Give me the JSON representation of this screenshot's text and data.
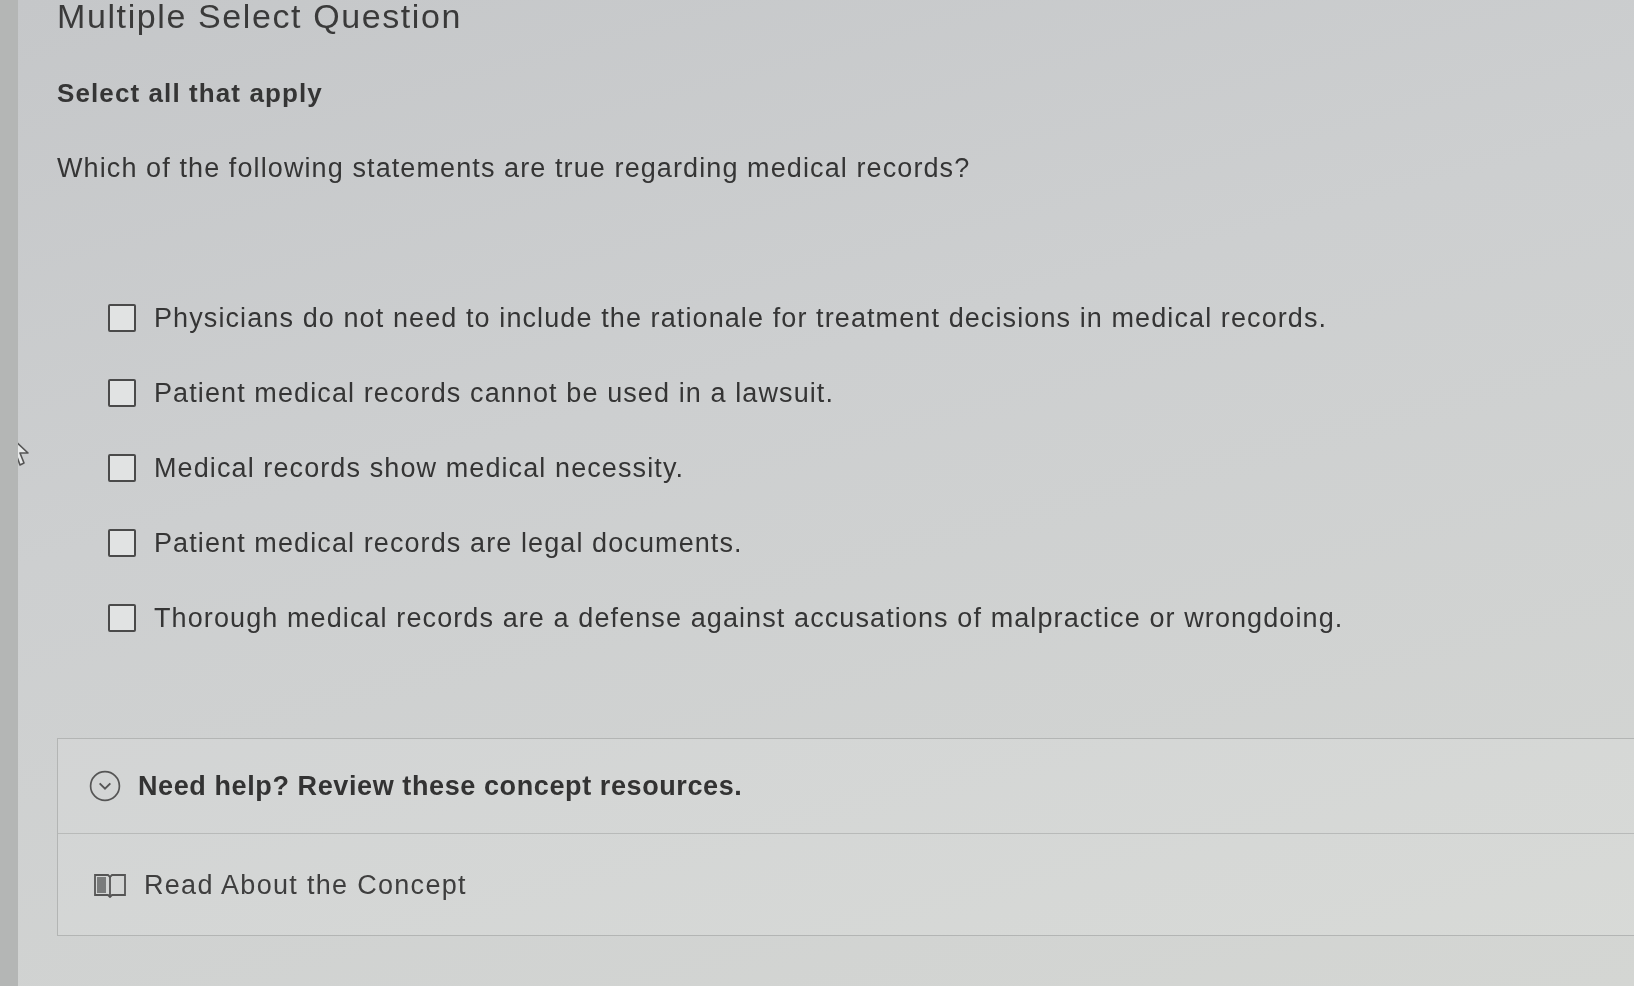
{
  "heading": {
    "title": "Multiple Select Question",
    "instruction": "Select all that apply",
    "prompt": "Which of the following statements are true regarding medical records?"
  },
  "options": [
    {
      "label": "Physicians do not need to include the rationale for treatment decisions in medical records.",
      "checked": false
    },
    {
      "label": "Patient medical records cannot be used in a lawsuit.",
      "checked": false
    },
    {
      "label": "Medical records show medical necessity.",
      "checked": false
    },
    {
      "label": "Patient medical records are legal documents.",
      "checked": false
    },
    {
      "label": "Thorough medical records are a defense against accusations of malpractice or wrongdoing.",
      "checked": false
    }
  ],
  "help": {
    "title": "Need help? Review these concept resources.",
    "expanded": true,
    "resources": [
      {
        "label": "Read About the Concept"
      }
    ]
  }
}
